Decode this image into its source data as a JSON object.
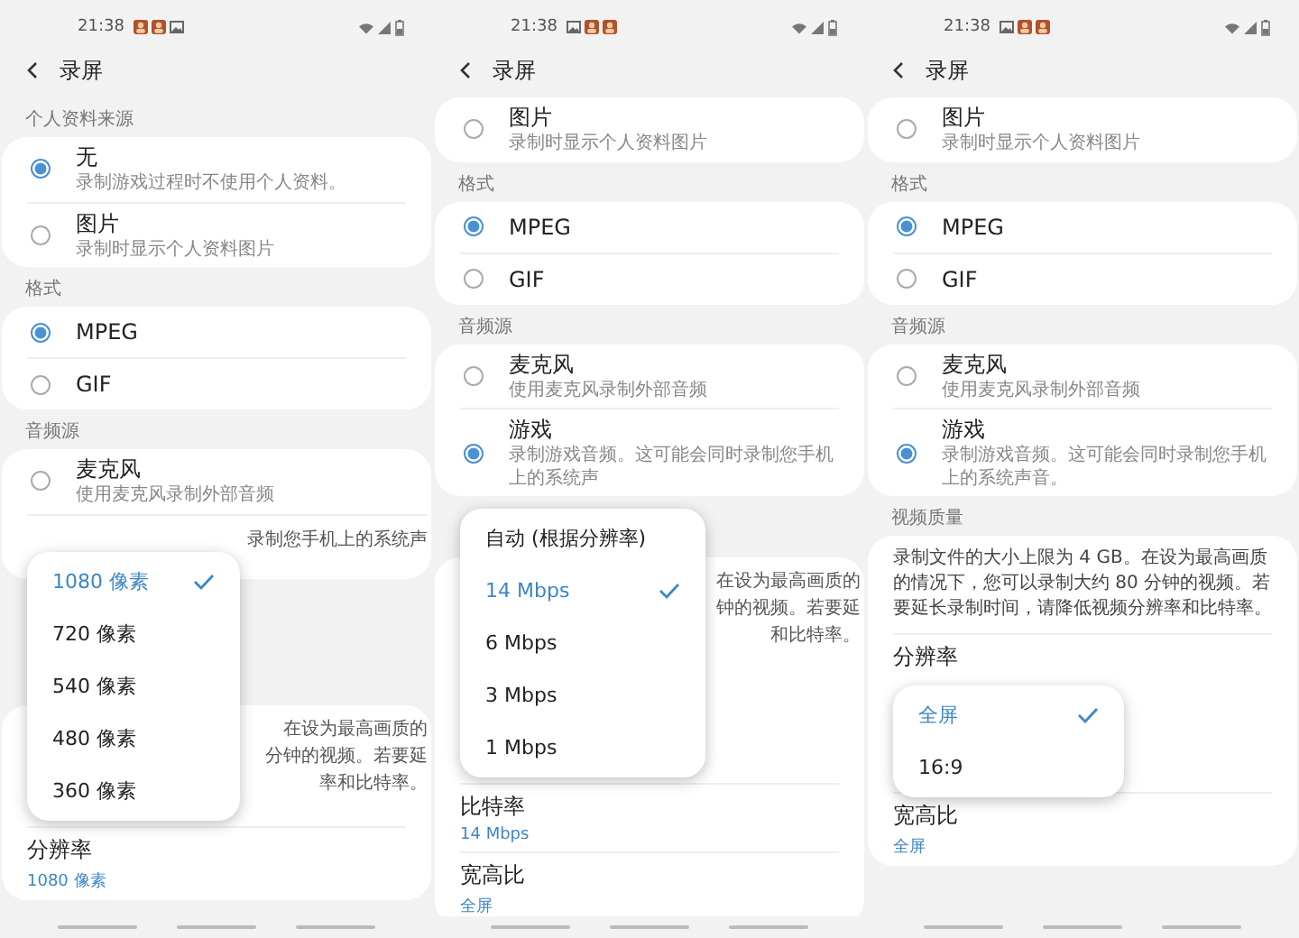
{
  "panels": [
    {
      "status_bar": {
        "time": "21:38",
        "notifications": [
          {
            "kind": "app"
          },
          {
            "kind": "app"
          },
          {
            "kind": "image"
          }
        ]
      },
      "header": {
        "title": "录屏"
      },
      "sections": [
        {
          "label": "个人资料来源",
          "items": [
            {
              "kind": "radio",
              "title": "无",
              "subtitle": "录制游戏过程时不使用个人资料。",
              "selected": true
            },
            {
              "kind": "radio",
              "title": "图片",
              "subtitle": "录制时显示个人资料图片",
              "selected": false
            }
          ]
        },
        {
          "label": "格式",
          "items": [
            {
              "kind": "radio",
              "title": "MPEG",
              "selected": true
            },
            {
              "kind": "radio",
              "title": "GIF",
              "selected": false
            }
          ]
        },
        {
          "label": "音频源",
          "items": [
            {
              "kind": "radio",
              "title": "麦克风",
              "subtitle": "使用麦克风录制外部音频",
              "selected": false
            },
            {
              "kind": "fragment",
              "lines": [
                "录制您手机上的系统声"
              ]
            }
          ]
        },
        {
          "items": [
            {
              "kind": "fragment",
              "lines": [
                "在设为最高画质的",
                "分钟的视频。若要延",
                "率和比特率。"
              ]
            },
            {
              "kind": "setting",
              "title": "分辨率",
              "value": "1080 像素"
            }
          ]
        }
      ],
      "popup": {
        "options": [
          {
            "label": "1080 像素",
            "selected": true
          },
          {
            "label": "720 像素",
            "selected": false
          },
          {
            "label": "540 像素",
            "selected": false
          },
          {
            "label": "480 像素",
            "selected": false
          },
          {
            "label": "360 像素",
            "selected": false
          }
        ]
      }
    },
    {
      "status_bar": {
        "time": "21:38",
        "notifications": [
          {
            "kind": "image"
          },
          {
            "kind": "app"
          },
          {
            "kind": "app"
          }
        ]
      },
      "header": {
        "title": "录屏"
      },
      "sections": [
        {
          "items": [
            {
              "kind": "radio",
              "title": "图片",
              "subtitle": "录制时显示个人资料图片",
              "selected": false
            }
          ]
        },
        {
          "label": "格式",
          "items": [
            {
              "kind": "radio",
              "title": "MPEG",
              "selected": true
            },
            {
              "kind": "radio",
              "title": "GIF",
              "selected": false
            }
          ]
        },
        {
          "label": "音频源",
          "items": [
            {
              "kind": "radio",
              "title": "麦克风",
              "subtitle": "使用麦克风录制外部音频",
              "selected": false
            },
            {
              "kind": "radio",
              "title": "游戏",
              "subtitle": "录制游戏音频。这可能会同时录制您手机上的系统声",
              "selected": true
            }
          ]
        },
        {
          "items": [
            {
              "kind": "fragment",
              "lines": [
                "在设为最高画质的",
                "钟的视频。若要延",
                "和比特率。"
              ]
            },
            {
              "kind": "setting",
              "title": "比特率",
              "value": "14 Mbps"
            },
            {
              "kind": "setting",
              "title": "宽高比",
              "value": "全屏"
            }
          ]
        }
      ],
      "popup": {
        "options": [
          {
            "label": "自动 (根据分辨率)",
            "selected": false
          },
          {
            "label": "14 Mbps",
            "selected": true
          },
          {
            "label": "6 Mbps",
            "selected": false
          },
          {
            "label": "3 Mbps",
            "selected": false
          },
          {
            "label": "1 Mbps",
            "selected": false
          }
        ]
      }
    },
    {
      "status_bar": {
        "time": "21:38",
        "notifications": [
          {
            "kind": "image"
          },
          {
            "kind": "app"
          },
          {
            "kind": "app"
          }
        ]
      },
      "header": {
        "title": "录屏"
      },
      "sections": [
        {
          "items": [
            {
              "kind": "radio",
              "title": "图片",
              "subtitle": "录制时显示个人资料图片",
              "selected": false
            }
          ]
        },
        {
          "label": "格式",
          "items": [
            {
              "kind": "radio",
              "title": "MPEG",
              "selected": true
            },
            {
              "kind": "radio",
              "title": "GIF",
              "selected": false
            }
          ]
        },
        {
          "label": "音频源",
          "items": [
            {
              "kind": "radio",
              "title": "麦克风",
              "subtitle": "使用麦克风录制外部音频",
              "selected": false
            },
            {
              "kind": "radio",
              "title": "游戏",
              "subtitle": "录制游戏音频。这可能会同时录制您手机上的系统声音。",
              "selected": true
            }
          ]
        },
        {
          "label": "视频质量",
          "items": [
            {
              "kind": "paragraph",
              "text": "录制文件的大小上限为 4 GB。在设为最高画质的情况下，您可以录制大约 80 分钟的视频。若要延长录制时间，请降低视频分辨率和比特率。"
            },
            {
              "kind": "setting",
              "title": "分辨率"
            },
            {
              "kind": "setting",
              "title": "宽高比",
              "value": "全屏"
            }
          ]
        }
      ],
      "popup": {
        "options": [
          {
            "label": "全屏",
            "selected": true
          },
          {
            "label": "16:9",
            "selected": false
          }
        ]
      }
    }
  ]
}
